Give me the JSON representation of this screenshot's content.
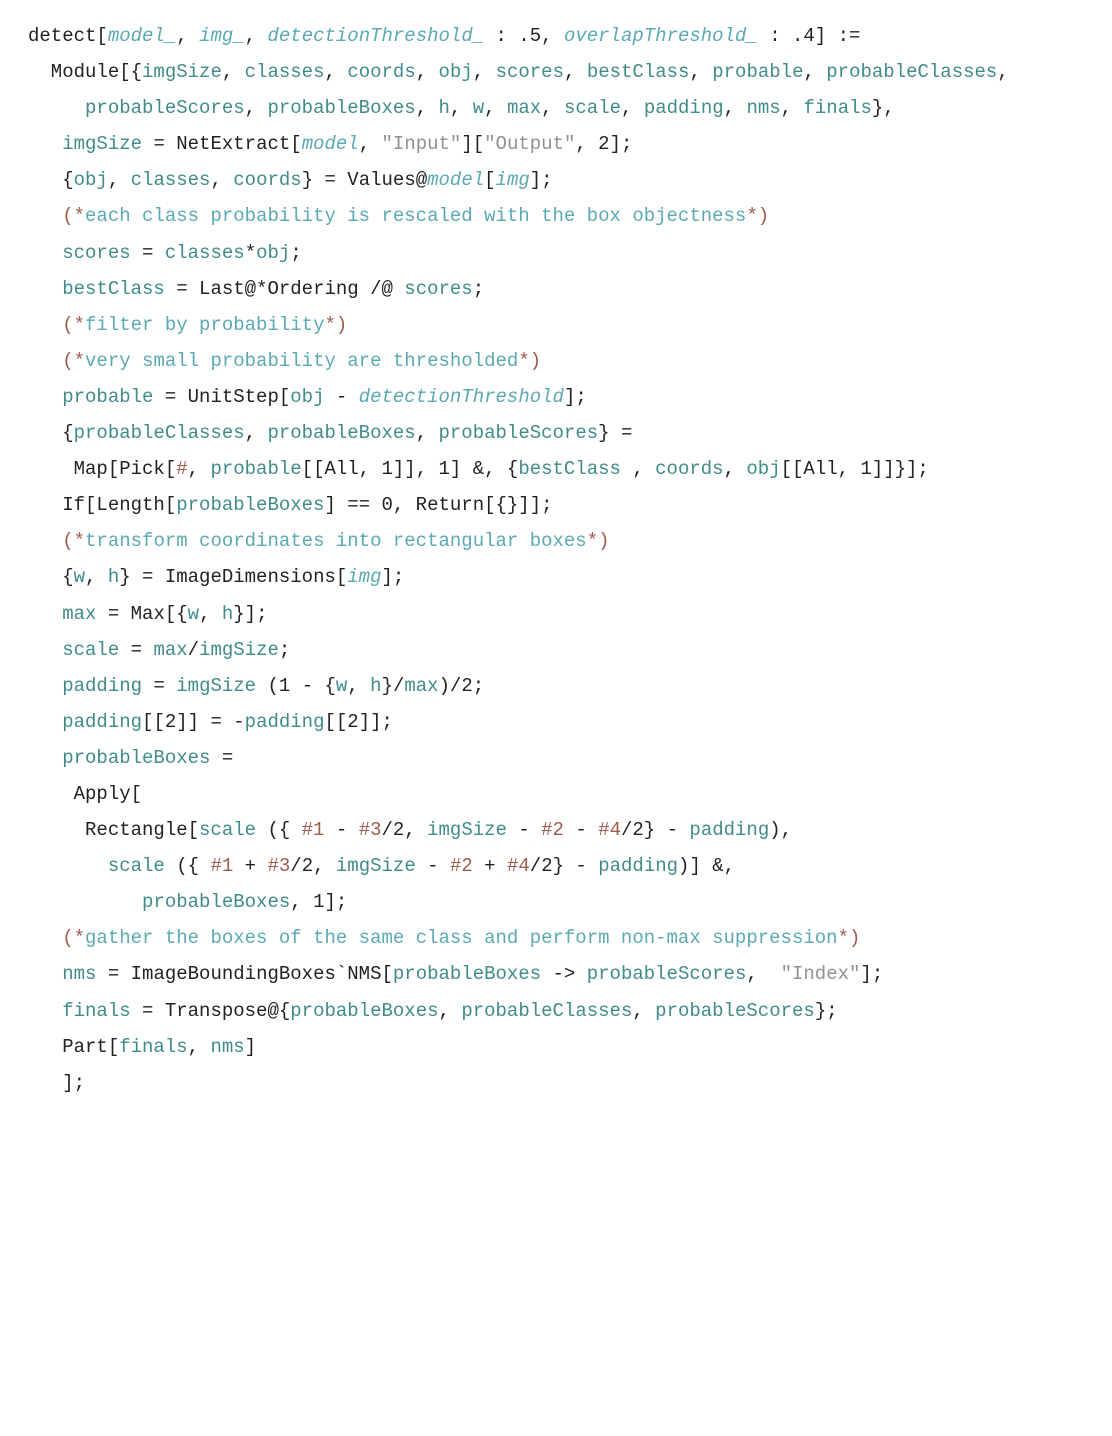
{
  "lines": [
    [
      {
        "cls": "p",
        "t": "detect["
      },
      {
        "cls": "it",
        "t": "model_"
      },
      {
        "cls": "p",
        "t": ", "
      },
      {
        "cls": "it",
        "t": "img_"
      },
      {
        "cls": "p",
        "t": ", "
      },
      {
        "cls": "it",
        "t": "detectionThreshold_"
      },
      {
        "cls": "p",
        "t": " : .5, "
      },
      {
        "cls": "it",
        "t": "overlapThreshold_"
      },
      {
        "cls": "p",
        "t": " : .4] := "
      }
    ],
    [
      {
        "cls": "p",
        "t": "  Module[{"
      },
      {
        "cls": "lv",
        "t": "imgSize"
      },
      {
        "cls": "p",
        "t": ", "
      },
      {
        "cls": "lv",
        "t": "classes"
      },
      {
        "cls": "p",
        "t": ", "
      },
      {
        "cls": "lv",
        "t": "coords"
      },
      {
        "cls": "p",
        "t": ", "
      },
      {
        "cls": "lv",
        "t": "obj"
      },
      {
        "cls": "p",
        "t": ", "
      },
      {
        "cls": "lv",
        "t": "scores"
      },
      {
        "cls": "p",
        "t": ", "
      },
      {
        "cls": "lv",
        "t": "bestClass"
      },
      {
        "cls": "p",
        "t": ", "
      },
      {
        "cls": "lv",
        "t": "probable"
      },
      {
        "cls": "p",
        "t": ", "
      },
      {
        "cls": "lv",
        "t": "probableClasses"
      },
      {
        "cls": "p",
        "t": ","
      }
    ],
    [
      {
        "cls": "p",
        "t": "     "
      },
      {
        "cls": "lv",
        "t": "probableScores"
      },
      {
        "cls": "p",
        "t": ", "
      },
      {
        "cls": "lv",
        "t": "probableBoxes"
      },
      {
        "cls": "p",
        "t": ", "
      },
      {
        "cls": "lv",
        "t": "h"
      },
      {
        "cls": "p",
        "t": ", "
      },
      {
        "cls": "lv",
        "t": "w"
      },
      {
        "cls": "p",
        "t": ", "
      },
      {
        "cls": "lv",
        "t": "max"
      },
      {
        "cls": "p",
        "t": ", "
      },
      {
        "cls": "lv",
        "t": "scale"
      },
      {
        "cls": "p",
        "t": ", "
      },
      {
        "cls": "lv",
        "t": "padding"
      },
      {
        "cls": "p",
        "t": ", "
      },
      {
        "cls": "lv",
        "t": "nms"
      },
      {
        "cls": "p",
        "t": ", "
      },
      {
        "cls": "lv",
        "t": "finals"
      },
      {
        "cls": "p",
        "t": "},"
      }
    ],
    [
      {
        "cls": "p",
        "t": "   "
      },
      {
        "cls": "lv",
        "t": "imgSize"
      },
      {
        "cls": "p",
        "t": " = NetExtract["
      },
      {
        "cls": "it",
        "t": "model"
      },
      {
        "cls": "p",
        "t": ", "
      },
      {
        "cls": "s",
        "t": "\"Input\""
      },
      {
        "cls": "p",
        "t": "]["
      },
      {
        "cls": "s",
        "t": "\"Output\""
      },
      {
        "cls": "p",
        "t": ", 2];"
      }
    ],
    [
      {
        "cls": "p",
        "t": "   {"
      },
      {
        "cls": "lv",
        "t": "obj"
      },
      {
        "cls": "p",
        "t": ", "
      },
      {
        "cls": "lv",
        "t": "classes"
      },
      {
        "cls": "p",
        "t": ", "
      },
      {
        "cls": "lv",
        "t": "coords"
      },
      {
        "cls": "p",
        "t": "} = Values@"
      },
      {
        "cls": "it",
        "t": "model"
      },
      {
        "cls": "p",
        "t": "["
      },
      {
        "cls": "it",
        "t": "img"
      },
      {
        "cls": "p",
        "t": "];"
      }
    ],
    [
      {
        "cls": "p",
        "t": "   "
      },
      {
        "cls": "cmd",
        "t": "(*"
      },
      {
        "cls": "cm",
        "t": "each class probability is rescaled with the box objectness"
      },
      {
        "cls": "cmd",
        "t": "*)"
      }
    ],
    [
      {
        "cls": "p",
        "t": "   "
      },
      {
        "cls": "lv",
        "t": "scores"
      },
      {
        "cls": "p",
        "t": " = "
      },
      {
        "cls": "lv",
        "t": "classes"
      },
      {
        "cls": "p",
        "t": "*"
      },
      {
        "cls": "lv",
        "t": "obj"
      },
      {
        "cls": "p",
        "t": ";"
      }
    ],
    [
      {
        "cls": "p",
        "t": "   "
      },
      {
        "cls": "lv",
        "t": "bestClass"
      },
      {
        "cls": "p",
        "t": " = Last@*Ordering /@ "
      },
      {
        "cls": "lv",
        "t": "scores"
      },
      {
        "cls": "p",
        "t": ";"
      }
    ],
    [
      {
        "cls": "p",
        "t": "   "
      },
      {
        "cls": "cmd",
        "t": "(*"
      },
      {
        "cls": "cm",
        "t": "filter by probability"
      },
      {
        "cls": "cmd",
        "t": "*)"
      }
    ],
    [
      {
        "cls": "p",
        "t": "   "
      },
      {
        "cls": "cmd",
        "t": "(*"
      },
      {
        "cls": "cm",
        "t": "very small probability are thresholded"
      },
      {
        "cls": "cmd",
        "t": "*)"
      }
    ],
    [
      {
        "cls": "p",
        "t": "   "
      },
      {
        "cls": "lv",
        "t": "probable"
      },
      {
        "cls": "p",
        "t": " = UnitStep["
      },
      {
        "cls": "lv",
        "t": "obj"
      },
      {
        "cls": "p",
        "t": " - "
      },
      {
        "cls": "it",
        "t": "detectionThreshold"
      },
      {
        "cls": "p",
        "t": "];"
      }
    ],
    [
      {
        "cls": "p",
        "t": "   {"
      },
      {
        "cls": "lv",
        "t": "probableClasses"
      },
      {
        "cls": "p",
        "t": ", "
      },
      {
        "cls": "lv",
        "t": "probableBoxes"
      },
      {
        "cls": "p",
        "t": ", "
      },
      {
        "cls": "lv",
        "t": "probableScores"
      },
      {
        "cls": "p",
        "t": "} = "
      }
    ],
    [
      {
        "cls": "p",
        "t": "    Map[Pick["
      },
      {
        "cls": "ds",
        "t": "#"
      },
      {
        "cls": "p",
        "t": ", "
      },
      {
        "cls": "lv",
        "t": "probable"
      },
      {
        "cls": "p",
        "t": "[[All, 1]], 1] &, {"
      },
      {
        "cls": "lv",
        "t": "bestClass"
      },
      {
        "cls": "p",
        "t": " , "
      },
      {
        "cls": "lv",
        "t": "coords"
      },
      {
        "cls": "p",
        "t": ", "
      },
      {
        "cls": "lv",
        "t": "obj"
      },
      {
        "cls": "p",
        "t": "[[All, 1]]}];"
      }
    ],
    [
      {
        "cls": "p",
        "t": "   If[Length["
      },
      {
        "cls": "lv",
        "t": "probableBoxes"
      },
      {
        "cls": "p",
        "t": "] == 0, Return[{}]];"
      }
    ],
    [
      {
        "cls": "p",
        "t": "   "
      },
      {
        "cls": "cmd",
        "t": "(*"
      },
      {
        "cls": "cm",
        "t": "transform coordinates into rectangular boxes"
      },
      {
        "cls": "cmd",
        "t": "*)"
      }
    ],
    [
      {
        "cls": "p",
        "t": "   {"
      },
      {
        "cls": "lv",
        "t": "w"
      },
      {
        "cls": "p",
        "t": ", "
      },
      {
        "cls": "lv",
        "t": "h"
      },
      {
        "cls": "p",
        "t": "} = ImageDimensions["
      },
      {
        "cls": "it",
        "t": "img"
      },
      {
        "cls": "p",
        "t": "];"
      }
    ],
    [
      {
        "cls": "p",
        "t": "   "
      },
      {
        "cls": "lv",
        "t": "max"
      },
      {
        "cls": "p",
        "t": " = Max[{"
      },
      {
        "cls": "lv",
        "t": "w"
      },
      {
        "cls": "p",
        "t": ", "
      },
      {
        "cls": "lv",
        "t": "h"
      },
      {
        "cls": "p",
        "t": "}];"
      }
    ],
    [
      {
        "cls": "p",
        "t": "   "
      },
      {
        "cls": "lv",
        "t": "scale"
      },
      {
        "cls": "p",
        "t": " = "
      },
      {
        "cls": "lv",
        "t": "max"
      },
      {
        "cls": "p",
        "t": "/"
      },
      {
        "cls": "lv",
        "t": "imgSize"
      },
      {
        "cls": "p",
        "t": ";"
      }
    ],
    [
      {
        "cls": "p",
        "t": "   "
      },
      {
        "cls": "lv",
        "t": "padding"
      },
      {
        "cls": "p",
        "t": " = "
      },
      {
        "cls": "lv",
        "t": "imgSize"
      },
      {
        "cls": "p",
        "t": " (1 - {"
      },
      {
        "cls": "lv",
        "t": "w"
      },
      {
        "cls": "p",
        "t": ", "
      },
      {
        "cls": "lv",
        "t": "h"
      },
      {
        "cls": "p",
        "t": "}/"
      },
      {
        "cls": "lv",
        "t": "max"
      },
      {
        "cls": "p",
        "t": ")/2;"
      }
    ],
    [
      {
        "cls": "p",
        "t": "   "
      },
      {
        "cls": "lv",
        "t": "padding"
      },
      {
        "cls": "p",
        "t": "[[2]] = -"
      },
      {
        "cls": "lv",
        "t": "padding"
      },
      {
        "cls": "p",
        "t": "[[2]];"
      }
    ],
    [
      {
        "cls": "p",
        "t": "   "
      },
      {
        "cls": "lv",
        "t": "probableBoxes"
      },
      {
        "cls": "p",
        "t": " = "
      }
    ],
    [
      {
        "cls": "p",
        "t": "    Apply["
      }
    ],
    [
      {
        "cls": "p",
        "t": "     Rectangle["
      },
      {
        "cls": "lv",
        "t": "scale"
      },
      {
        "cls": "p",
        "t": " ({ "
      },
      {
        "cls": "ds",
        "t": "#1"
      },
      {
        "cls": "p",
        "t": " - "
      },
      {
        "cls": "ds",
        "t": "#3"
      },
      {
        "cls": "p",
        "t": "/2, "
      },
      {
        "cls": "lv",
        "t": "imgSize"
      },
      {
        "cls": "p",
        "t": " - "
      },
      {
        "cls": "ds",
        "t": "#2"
      },
      {
        "cls": "p",
        "t": " - "
      },
      {
        "cls": "ds",
        "t": "#4"
      },
      {
        "cls": "p",
        "t": "/2} - "
      },
      {
        "cls": "lv",
        "t": "padding"
      },
      {
        "cls": "p",
        "t": "), "
      }
    ],
    [
      {
        "cls": "p",
        "t": "       "
      },
      {
        "cls": "lv",
        "t": "scale"
      },
      {
        "cls": "p",
        "t": " ({ "
      },
      {
        "cls": "ds",
        "t": "#1"
      },
      {
        "cls": "p",
        "t": " + "
      },
      {
        "cls": "ds",
        "t": "#3"
      },
      {
        "cls": "p",
        "t": "/2, "
      },
      {
        "cls": "lv",
        "t": "imgSize"
      },
      {
        "cls": "p",
        "t": " - "
      },
      {
        "cls": "ds",
        "t": "#2"
      },
      {
        "cls": "p",
        "t": " + "
      },
      {
        "cls": "ds",
        "t": "#4"
      },
      {
        "cls": "p",
        "t": "/2} - "
      },
      {
        "cls": "lv",
        "t": "padding"
      },
      {
        "cls": "p",
        "t": ")] &, "
      }
    ],
    [
      {
        "cls": "p",
        "t": "          "
      },
      {
        "cls": "lv",
        "t": "probableBoxes"
      },
      {
        "cls": "p",
        "t": ", 1];"
      }
    ],
    [
      {
        "cls": "p",
        "t": "   "
      },
      {
        "cls": "cmd",
        "t": "(*"
      },
      {
        "cls": "cm",
        "t": "gather the boxes of the same class and perform non-max suppression"
      },
      {
        "cls": "cmd",
        "t": "*)"
      }
    ],
    [
      {
        "cls": "p",
        "t": "   "
      },
      {
        "cls": "lv",
        "t": "nms"
      },
      {
        "cls": "p",
        "t": " = ImageBoundingBoxes`NMS["
      },
      {
        "cls": "lv",
        "t": "probableBoxes"
      },
      {
        "cls": "p",
        "t": " -> "
      },
      {
        "cls": "lv",
        "t": "probableScores"
      },
      {
        "cls": "p",
        "t": ",  "
      },
      {
        "cls": "s",
        "t": "\"Index\""
      },
      {
        "cls": "p",
        "t": "];"
      }
    ],
    [
      {
        "cls": "p",
        "t": "   "
      },
      {
        "cls": "lv",
        "t": "finals"
      },
      {
        "cls": "p",
        "t": " = Transpose@{"
      },
      {
        "cls": "lv",
        "t": "probableBoxes"
      },
      {
        "cls": "p",
        "t": ", "
      },
      {
        "cls": "lv",
        "t": "probableClasses"
      },
      {
        "cls": "p",
        "t": ", "
      },
      {
        "cls": "lv",
        "t": "probableScores"
      },
      {
        "cls": "p",
        "t": "};"
      }
    ],
    [
      {
        "cls": "p",
        "t": "   Part["
      },
      {
        "cls": "lv",
        "t": "finals"
      },
      {
        "cls": "p",
        "t": ", "
      },
      {
        "cls": "lv",
        "t": "nms"
      },
      {
        "cls": "p",
        "t": "]"
      }
    ],
    [
      {
        "cls": "p",
        "t": "   ];"
      }
    ]
  ]
}
